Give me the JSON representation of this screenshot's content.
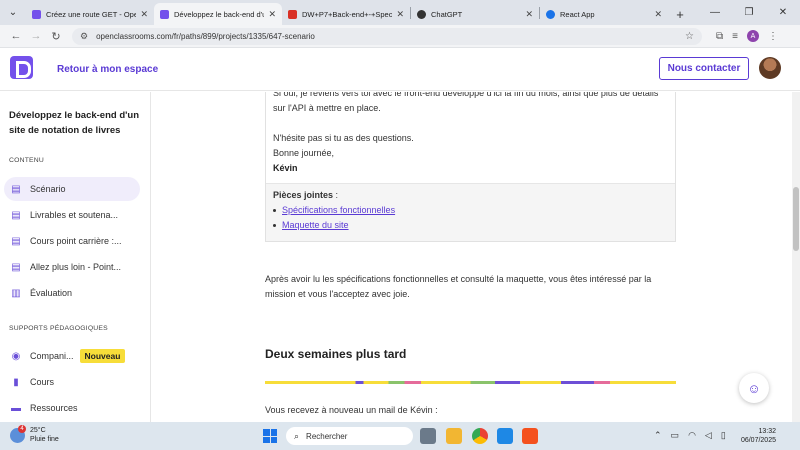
{
  "browser": {
    "tabs": [
      {
        "title": "Créez une route GET - Open",
        "color": "#7451eb",
        "active": false
      },
      {
        "title": "Développez le back-end d'u",
        "color": "#7451eb",
        "active": true
      },
      {
        "title": "DW+P7+Back-end+-+Spec",
        "color": "#d93025",
        "active": false
      },
      {
        "title": "ChatGPT",
        "color": "#333333",
        "active": false
      },
      {
        "title": "React App",
        "color": "#1a73e8",
        "active": false
      }
    ],
    "url": "openclassrooms.com/fr/paths/899/projects/1335/647-scenario",
    "profile_initial": "A"
  },
  "header": {
    "back_label": "Retour à mon espace",
    "contact_label": "Nous contacter"
  },
  "sidebar": {
    "course_title": "Développez le back-end d'un site de notation de livres",
    "content_label": "CONTENU",
    "content_items": [
      {
        "label": "Scénario",
        "icon": "document-icon",
        "active": true
      },
      {
        "label": "Livrables et soutena...",
        "icon": "document-icon"
      },
      {
        "label": "Cours point carrière :...",
        "icon": "document-icon"
      },
      {
        "label": "Allez plus loin - Point...",
        "icon": "document-icon"
      },
      {
        "label": "Évaluation",
        "icon": "chart-icon"
      }
    ],
    "support_label": "SUPPORTS PÉDAGOGIQUES",
    "support_items": [
      {
        "label": "Compani...",
        "icon": "companion-icon",
        "badge": "Nouveau"
      },
      {
        "label": "Cours",
        "icon": "book-icon"
      },
      {
        "label": "Ressources",
        "icon": "resources-icon"
      }
    ]
  },
  "main": {
    "mail": {
      "line1": "Si oui, je reviens vers toi avec le front-end développé d'ici la fin du mois, ainsi que plus de détails sur l'API à mettre en place.",
      "line2": "N'hésite pas si tu as des questions.",
      "line3": "Bonne journée,",
      "signature": "Kévin",
      "attachments_label": "Pièces jointes",
      "attachments_suffix": " :",
      "attachments": [
        "Spécifications fonctionnelles",
        "Maquette du site"
      ]
    },
    "paragraph": "Après avoir lu les spécifications fonctionnelles et consulté la maquette, vous êtes intéressé par la mission et vous l'acceptez avec joie.",
    "section_title": "Deux semaines plus tard",
    "next_paragraph": "Vous recevez à nouveau un mail de Kévin :"
  },
  "taskbar": {
    "weather_temp": "25°C",
    "weather_desc": "Pluie fine",
    "weather_badge": "4",
    "search_placeholder": "Rechercher",
    "time": "13:32",
    "date": "06/07/2025"
  }
}
